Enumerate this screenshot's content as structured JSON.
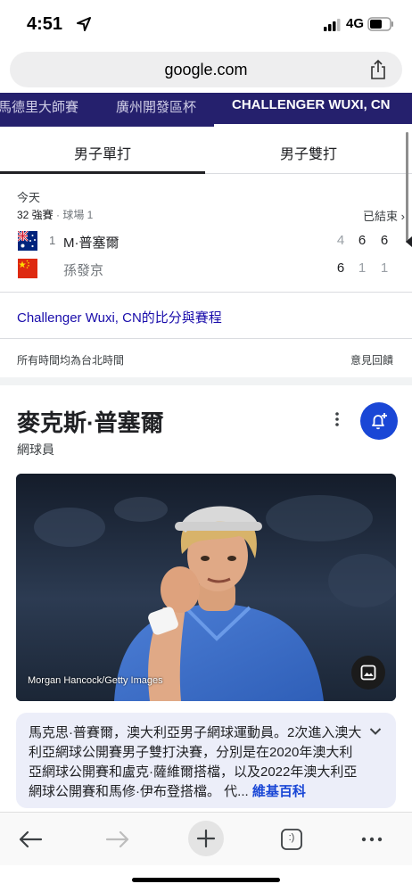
{
  "status_bar": {
    "time": "4:51",
    "network": "4G",
    "icons": [
      "location-arrow-icon",
      "signal-bars-icon",
      "battery-icon"
    ]
  },
  "address_bar": {
    "url": "google.com",
    "icons": [
      "share-icon"
    ]
  },
  "tournament_tabs": [
    "馬德里大師賽",
    "廣州開發區杯",
    "CHALLENGER WUXI, CN"
  ],
  "event_tabs": [
    "男子單打",
    "男子雙打"
  ],
  "match": {
    "day": "今天",
    "round": "32 強賽",
    "court": " · 球場 1",
    "status": "已結束 ›",
    "players": [
      {
        "seed": "1",
        "name": "M·普塞爾",
        "flag": "australia-flag",
        "scores": [
          "4",
          "6",
          "6"
        ]
      },
      {
        "seed": "",
        "name": "孫發京",
        "flag": "china-flag",
        "scores": [
          "6",
          "1",
          "1"
        ]
      }
    ]
  },
  "tournament_link": "Challenger Wuxi, CN的比分與賽程",
  "footer": {
    "timezone_note": "所有時間均為台北時間",
    "feedback": "意見回饋"
  },
  "knowledge_panel": {
    "title": "麥克斯·普塞爾",
    "subtitle": "網球員",
    "photo_credit": "Morgan Hancock/Getty Images",
    "summary": "馬克思·普賽爾，澳大利亞男子網球運動員。2次進入澳大利亞網球公開賽男子雙打決賽，分別是在2020年澳大利亞網球公開賽和盧克·薩維爾搭檔，以及2022年澳大利亞網球公開賽和馬修·伊布登搭檔。 代... ",
    "wiki_link": "維基百科",
    "icons": [
      "kebab-menu-icon",
      "bell-add-icon",
      "image-icon",
      "chevron-down-icon"
    ]
  },
  "toolbar": {
    "icons": [
      "back-arrow-icon",
      "forward-arrow-icon",
      "plus-icon",
      "tabs-icon",
      "more-icon"
    ],
    "tab_badge": ":)"
  },
  "colors": {
    "tournament_bar": "#25206d",
    "link_blue": "#1a0dab",
    "accent_blue": "#1a47d6",
    "summary_bg": "#eceef9"
  }
}
